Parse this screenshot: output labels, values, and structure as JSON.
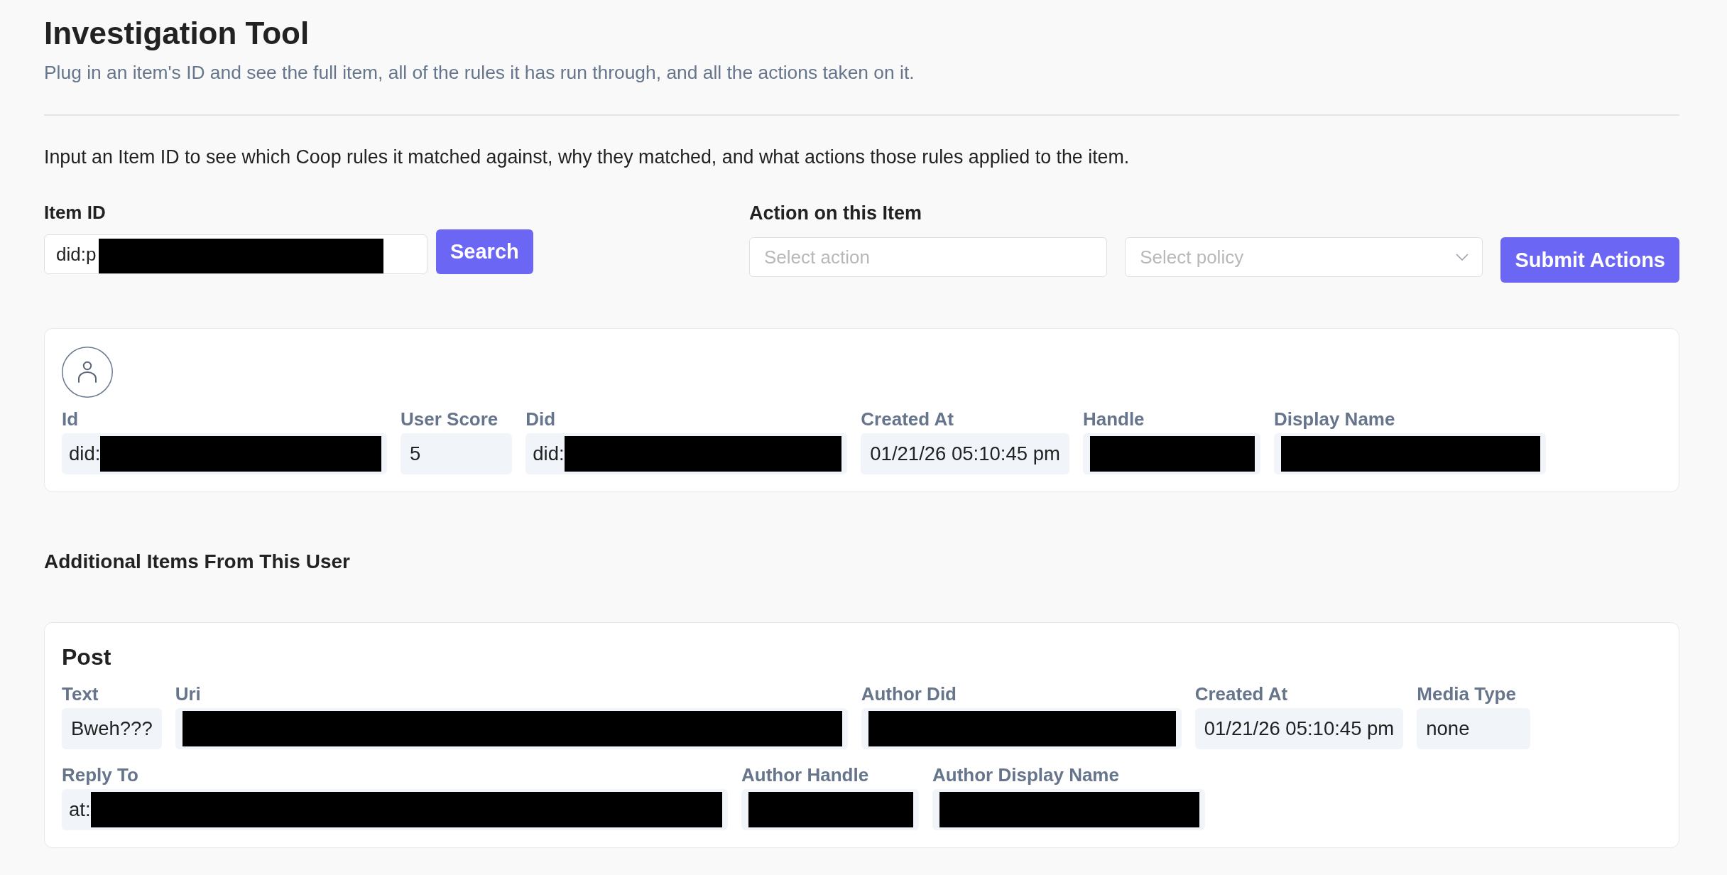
{
  "header": {
    "title": "Investigation Tool",
    "subtitle": "Plug in an item's ID and see the full item, all of the rules it has run through, and all the actions taken on it.",
    "intro": "Input an Item ID to see which Coop rules it matched against, why they matched, and what actions those rules applied to the item."
  },
  "item_search": {
    "label": "Item ID",
    "value": "did:p",
    "redacted": true,
    "button": "Search"
  },
  "actions": {
    "title": "Action on this Item",
    "action_field": {
      "placeholder": "Select action"
    },
    "policy_field": {
      "placeholder": "Select policy"
    },
    "button": "Submit Actions"
  },
  "user_card": {
    "fields": [
      {
        "label": "Id",
        "value": "did:",
        "redacted": true
      },
      {
        "label": "User Score",
        "value": "5",
        "redacted": false
      },
      {
        "label": "Did",
        "value": "did:",
        "redacted": true
      },
      {
        "label": "Created At",
        "value": "01/21/26 05:10:45 pm",
        "redacted": false
      },
      {
        "label": "Handle",
        "redacted": true
      },
      {
        "label": "Display Name",
        "redacted": true
      }
    ]
  },
  "additional_items": {
    "title": "Additional Items From This User",
    "items": [
      {
        "title": "Post",
        "rows": [
          [
            {
              "label": "Text",
              "value": "Bweh???",
              "redacted": false
            },
            {
              "label": "Uri",
              "redacted": true
            },
            {
              "label": "Author Did",
              "redacted": true
            },
            {
              "label": "Created At",
              "value": "01/21/26 05:10:45 pm",
              "redacted": false
            },
            {
              "label": "Media Type",
              "value": "none",
              "redacted": false
            }
          ],
          [
            {
              "label": "Reply To",
              "value": "at:",
              "redacted": true
            },
            {
              "label": "Author Handle",
              "redacted": true
            },
            {
              "label": "Author Display Name",
              "redacted": true
            }
          ]
        ]
      }
    ]
  }
}
